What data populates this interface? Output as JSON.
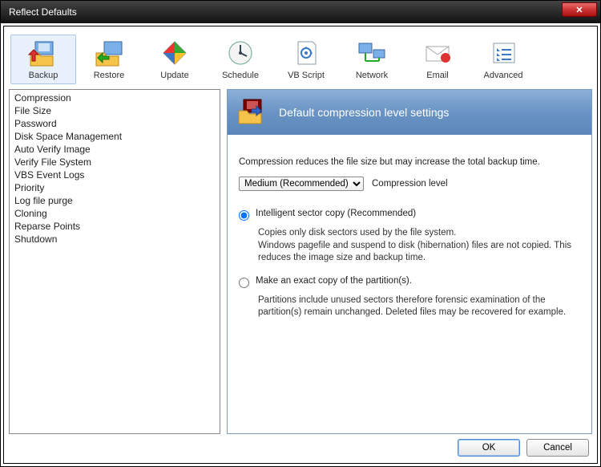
{
  "window": {
    "title": "Reflect Defaults",
    "close": "✕"
  },
  "toolbar": [
    {
      "id": "backup",
      "label": "Backup",
      "selected": true
    },
    {
      "id": "restore",
      "label": "Restore",
      "selected": false
    },
    {
      "id": "update",
      "label": "Update",
      "selected": false
    },
    {
      "id": "schedule",
      "label": "Schedule",
      "selected": false
    },
    {
      "id": "vbscript",
      "label": "VB Script",
      "selected": false
    },
    {
      "id": "network",
      "label": "Network",
      "selected": false
    },
    {
      "id": "email",
      "label": "Email",
      "selected": false
    },
    {
      "id": "advanced",
      "label": "Advanced",
      "selected": false
    }
  ],
  "sidebar": {
    "items": [
      "Compression",
      "File Size",
      "Password",
      "Disk Space Management",
      "Auto Verify Image",
      "Verify File System",
      "VBS Event Logs",
      "Priority",
      "Log file purge",
      "Cloning",
      "Reparse Points",
      "Shutdown"
    ]
  },
  "main": {
    "header": "Default compression level settings",
    "description": "Compression reduces the file size but may increase the total backup time.",
    "combo": {
      "value": "Medium (Recommended)",
      "label": "Compression level"
    },
    "radio1": {
      "label": "Intelligent sector copy    (Recommended)",
      "sub": "Copies only disk sectors used by the file system.\nWindows pagefile and suspend to disk (hibernation) files are not copied. This reduces the image size and backup time."
    },
    "radio2": {
      "label": "Make an exact copy of the partition(s).",
      "sub": "Partitions include unused sectors therefore forensic examination of the partition(s) remain unchanged. Deleted files may be recovered for example."
    }
  },
  "footer": {
    "ok": "OK",
    "cancel": "Cancel"
  }
}
